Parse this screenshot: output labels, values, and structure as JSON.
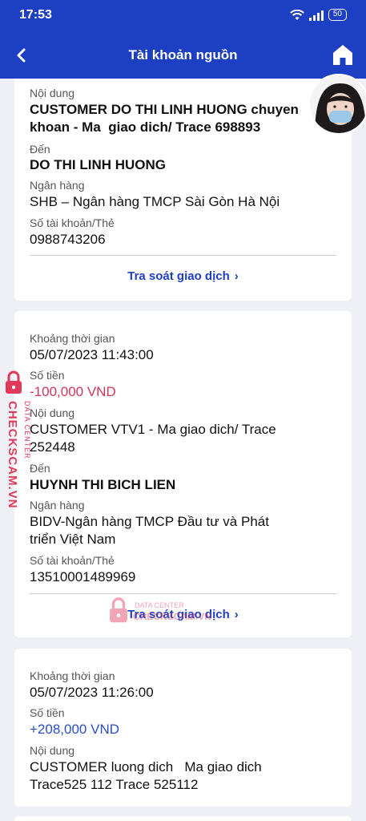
{
  "status_bar": {
    "time": "17:53",
    "battery": "50"
  },
  "header": {
    "title": "Tài khoản nguồn"
  },
  "icons": {
    "back": "chevron-left-icon",
    "home": "home-icon",
    "wifi": "wifi-icon",
    "signal": "signal-icon",
    "lock": "lock-icon"
  },
  "colors": {
    "brand": "#1d3fc4",
    "debit": "#d2365b",
    "credit": "#2a4cc9",
    "watermark": "#e23a5b"
  },
  "transactions": [
    {
      "content_label": "Nội dung",
      "content": "CUSTOMER DO THI LINH HUONG chuyen\nkhoan - Ma  giao dich/ Trace 698893",
      "to_label": "Đến",
      "to": "DO THI LINH HUONG",
      "bank_label": "Ngân hàng",
      "bank": "SHB – Ngân hàng TMCP Sài Gòn Hà Nội",
      "account_label": "Số tài khoản/Thẻ",
      "account": "0988743206",
      "trace_button": "Tra soát giao dịch"
    },
    {
      "time_label": "Khoảng thời gian",
      "time": "05/07/2023 11:43:00",
      "amount_label": "Số tiền",
      "amount": "-100,000 VND",
      "content_label": "Nội dung",
      "content": "CUSTOMER VTV1 - Ma giao dich/ Trace\n252448",
      "to_label": "Đến",
      "to": "HUYNH THI BICH LIEN",
      "bank_label": "Ngân hàng",
      "bank": "BIDV-Ngân hàng TMCP Đầu tư và Phát\ntriển Việt Nam",
      "account_label": "Số tài khoản/Thẻ",
      "account": "13510001489969",
      "trace_button": "Tra soát giao dịch"
    },
    {
      "time_label": "Khoảng thời gian",
      "time": "05/07/2023 11:26:00",
      "amount_label": "Số tiền",
      "amount": "+208,000 VND",
      "content_label": "Nội dung",
      "content": "CUSTOMER luong dich   Ma giao dich\nTrace525 112 Trace 525112"
    }
  ],
  "watermark": {
    "brand": "CHECKSCAM.VN",
    "sub": "DATA CENTER"
  }
}
